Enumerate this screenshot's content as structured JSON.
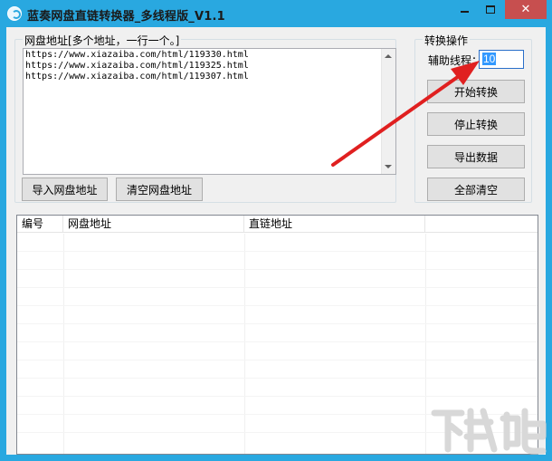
{
  "window": {
    "title": "蓝奏网盘直链转换器_多线程版_V1.1",
    "accent": "#29a8e0",
    "close_color": "#c74f4f",
    "controls": {
      "close_glyph": "✕"
    }
  },
  "url_group": {
    "label": "网盘地址[多个地址，一行一个。]",
    "lines": [
      "https://www.xiazaiba.com/html/119330.html",
      "https://www.xiazaiba.com/html/119325.html",
      "https://www.xiazaiba.com/html/119307.html"
    ],
    "import_label": "导入网盘地址",
    "clear_label": "清空网盘地址"
  },
  "ops_group": {
    "label": "转换操作",
    "threads_label": "辅助线程：",
    "threads_value": "10",
    "start_label": "开始转换",
    "stop_label": "停止转换",
    "export_label": "导出数据",
    "clear_all_label": "全部清空"
  },
  "results": {
    "columns": [
      "编号",
      "网盘地址",
      "直链地址"
    ]
  },
  "annotation": {
    "arrow_color": "#e02020"
  },
  "watermark": {
    "brand": "下载吧",
    "color": "#d8d8d8"
  }
}
